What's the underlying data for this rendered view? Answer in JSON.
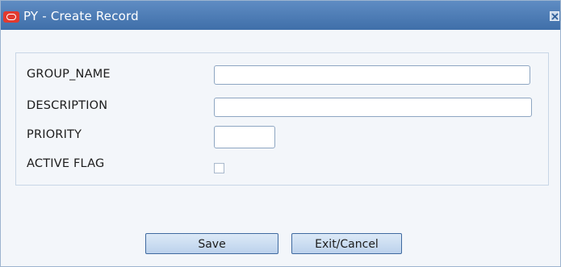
{
  "window": {
    "title": "PY - Create Record"
  },
  "form": {
    "fields": [
      {
        "label": "GROUP_NAME",
        "value": ""
      },
      {
        "label": "DESCRIPTION",
        "value": ""
      },
      {
        "label": "PRIORITY",
        "value": ""
      },
      {
        "label": "ACTIVE FLAG",
        "checked": false
      }
    ]
  },
  "buttons": {
    "save_label": "Save",
    "exit_label": "Exit/Cancel"
  },
  "icons": {
    "app_logo": "oracle-logo-icon",
    "close": "close-icon"
  },
  "colors": {
    "titlebar": "#4a78b3",
    "background": "#f3f6fa",
    "logo": "#e23a2f"
  }
}
